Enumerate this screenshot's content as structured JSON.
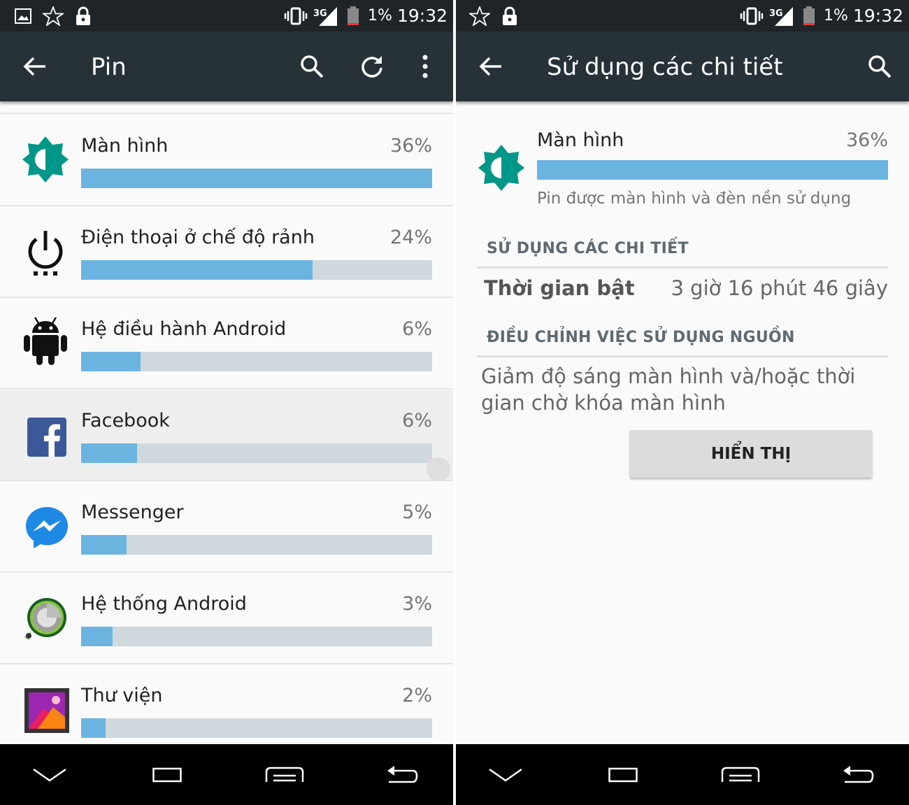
{
  "left": {
    "status": {
      "battery": "1%",
      "time": "19:32",
      "network": "3G"
    },
    "title": "Pin",
    "items": [
      {
        "name": "Màn hình",
        "percent": "36%",
        "usage": 1.0,
        "icon": "brightness-icon"
      },
      {
        "name": "Điện thoại ở chế độ rảnh",
        "percent": "24%",
        "usage": 0.66,
        "icon": "power-icon"
      },
      {
        "name": "Hệ điều hành Android",
        "percent": "6%",
        "usage": 0.17,
        "icon": "android-icon"
      },
      {
        "name": "Facebook",
        "percent": "6%",
        "usage": 0.16,
        "icon": "facebook-icon"
      },
      {
        "name": "Messenger",
        "percent": "5%",
        "usage": 0.13,
        "icon": "messenger-icon"
      },
      {
        "name": "Hệ thống Android",
        "percent": "3%",
        "usage": 0.09,
        "icon": "android-system-icon"
      },
      {
        "name": "Thư viện",
        "percent": "2%",
        "usage": 0.07,
        "icon": "gallery-icon"
      }
    ]
  },
  "right": {
    "status": {
      "battery": "1%",
      "time": "19:32",
      "network": "3G"
    },
    "title": "Sử dụng các chi tiết",
    "item": {
      "name": "Màn hình",
      "percent": "36%",
      "description": "Pin được màn hình và đèn nền sử dụng"
    },
    "usage_header": "SỬ DỤNG CÁC CHI TIẾT",
    "on_time_label": "Thời gian bật",
    "on_time_value": "3 giờ 16 phút 46 giây",
    "adjust_header": "ĐIỀU CHỈNH VIỆC SỬ DỤNG NGUỒN",
    "hint": "Giảm độ sáng màn hình và/hoặc thời gian chờ khóa màn hình",
    "button_label": "HIỂN THỊ"
  },
  "colors": {
    "statusbar": "#1f2429",
    "appbar": "#263238",
    "bar_fill": "#6cb4e0",
    "bar_track": "#cfd8dc",
    "brightness_icon": "#009688"
  }
}
